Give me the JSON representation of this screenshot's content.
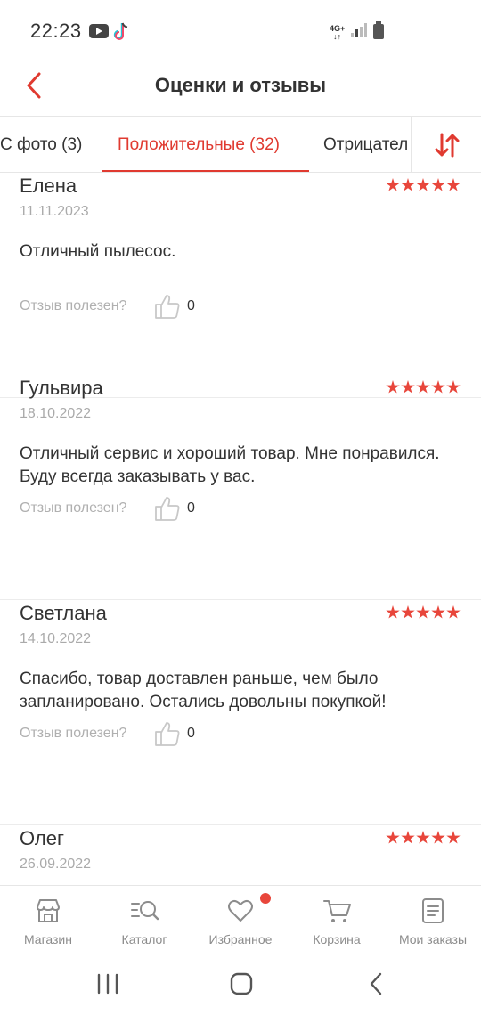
{
  "status_bar": {
    "time": "22:23",
    "network": "4G+"
  },
  "header": {
    "title": "Оценки и отзывы"
  },
  "tabs": [
    {
      "label": "С фото (3)"
    },
    {
      "label": "Положительные (32)",
      "active": true
    },
    {
      "label": "Отрицател"
    }
  ],
  "reviews": [
    {
      "author": "Елена",
      "date": "11.11.2023",
      "rating": 5,
      "text": "Отличный пылесос.",
      "helpful_label": "Отзыв полезен?",
      "likes": "0"
    },
    {
      "author": "Гульвира",
      "date": "18.10.2022",
      "rating": 5,
      "text": "Отличный сервис и хороший товар. Мне понравился. Буду всегда заказывать у вас.",
      "helpful_label": "Отзыв полезен?",
      "likes": "0"
    },
    {
      "author": "Светлана",
      "date": "14.10.2022",
      "rating": 5,
      "text": "Спасибо, товар доставлен раньше, чем было запланировано. Остались довольны покупкой!",
      "helpful_label": "Отзыв полезен?",
      "likes": "0"
    },
    {
      "author": "Олег",
      "date": "26.09.2022",
      "rating": 5,
      "text": "",
      "helpful_label": "",
      "likes": ""
    }
  ],
  "bottom_nav": [
    {
      "label": "Магазин",
      "icon": "store-icon"
    },
    {
      "label": "Каталог",
      "icon": "catalog-search-icon"
    },
    {
      "label": "Избранное",
      "icon": "heart-icon",
      "badge": true
    },
    {
      "label": "Корзина",
      "icon": "cart-icon"
    },
    {
      "label": "Мои заказы",
      "icon": "orders-icon"
    }
  ],
  "colors": {
    "accent": "#e03a30",
    "star": "#e8463b",
    "muted": "#aaaaaa"
  }
}
